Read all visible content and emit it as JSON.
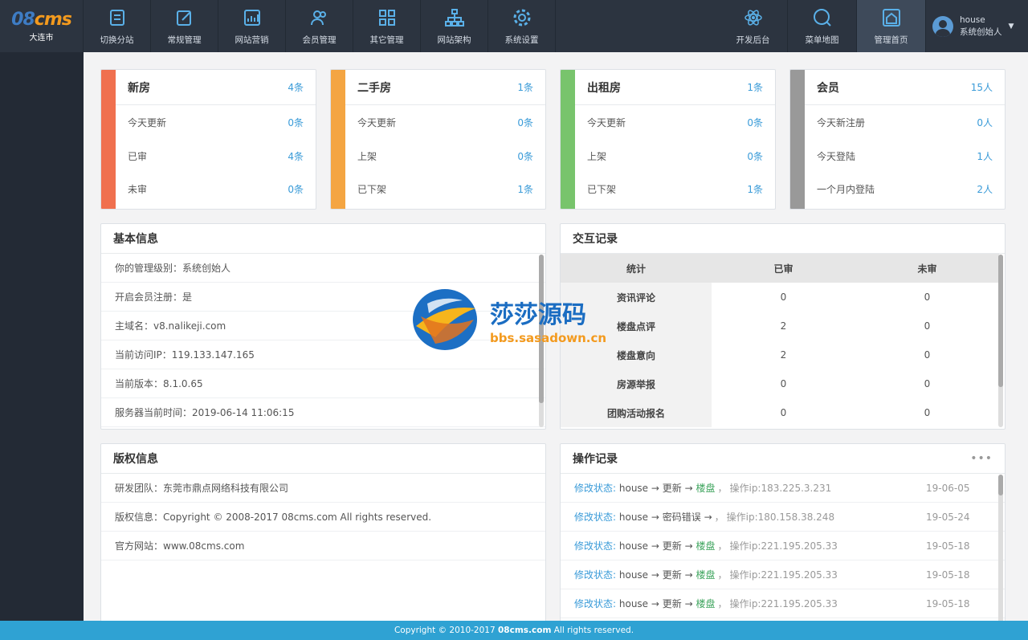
{
  "logo": {
    "prefix": "08",
    "brand": "cms",
    "city": "大连市"
  },
  "nav_left": [
    {
      "label": "切换分站",
      "icon": "switch-icon"
    },
    {
      "label": "常规管理",
      "icon": "edit-icon"
    },
    {
      "label": "网站营销",
      "icon": "chart-icon"
    },
    {
      "label": "会员管理",
      "icon": "users-icon"
    },
    {
      "label": "其它管理",
      "icon": "grid-icon"
    },
    {
      "label": "网站架构",
      "icon": "sitemap-icon"
    },
    {
      "label": "系统设置",
      "icon": "gear-icon"
    }
  ],
  "nav_right": [
    {
      "label": "开发后台",
      "icon": "atom-icon"
    },
    {
      "label": "菜单地图",
      "icon": "search-icon"
    },
    {
      "label": "管理首页",
      "icon": "home-icon",
      "active": true
    }
  ],
  "user": {
    "name": "house",
    "role": "系统创始人"
  },
  "stats": [
    {
      "title": "新房",
      "total": "4条",
      "color": "#f0704f",
      "rows": [
        {
          "label": "今天更新",
          "value": "0条"
        },
        {
          "label": "已审",
          "value": "4条"
        },
        {
          "label": "未审",
          "value": "0条"
        }
      ]
    },
    {
      "title": "二手房",
      "total": "1条",
      "color": "#f4a542",
      "rows": [
        {
          "label": "今天更新",
          "value": "0条"
        },
        {
          "label": "上架",
          "value": "0条"
        },
        {
          "label": "已下架",
          "value": "1条"
        }
      ]
    },
    {
      "title": "出租房",
      "total": "1条",
      "color": "#78c46c",
      "rows": [
        {
          "label": "今天更新",
          "value": "0条"
        },
        {
          "label": "上架",
          "value": "0条"
        },
        {
          "label": "已下架",
          "value": "1条"
        }
      ]
    },
    {
      "title": "会员",
      "total": "15人",
      "color": "#999999",
      "rows": [
        {
          "label": "今天新注册",
          "value": "0人"
        },
        {
          "label": "今天登陆",
          "value": "1人"
        },
        {
          "label": "一个月内登陆",
          "value": "2人"
        }
      ]
    }
  ],
  "basic_info": {
    "title": "基本信息",
    "rows": [
      "你的管理级别：系统创始人",
      "开启会员注册：是",
      "主域名：v8.nalikeji.com",
      "当前访问IP：119.133.147.165",
      "当前版本：8.1.0.65",
      "服务器当前时间：2019-06-14 11:06:15"
    ]
  },
  "interaction": {
    "title": "交互记录",
    "headers": [
      "统计",
      "已审",
      "未审"
    ],
    "rows": [
      [
        "资讯评论",
        "0",
        "0"
      ],
      [
        "楼盘点评",
        "2",
        "0"
      ],
      [
        "楼盘意向",
        "2",
        "0"
      ],
      [
        "房源举报",
        "0",
        "0"
      ],
      [
        "团购活动报名",
        "0",
        "0"
      ]
    ]
  },
  "copyright": {
    "title": "版权信息",
    "rows": [
      "研发团队：东莞市鼎点网络科技有限公司",
      "版权信息：Copyright © 2008-2017 08cms.com All rights reserved.",
      "官方网站：www.08cms.com"
    ]
  },
  "oplog": {
    "title": "操作记录",
    "more": "•••",
    "rows": [
      {
        "action": "修改状态:",
        "user": "house",
        "op": "更新",
        "target": "楼盘",
        "ip": "操作ip:183.225.3.231",
        "date": "19-06-05"
      },
      {
        "action": "修改状态:",
        "user": "house",
        "op": "密码错误",
        "target": "",
        "ip": "操作ip:180.158.38.248",
        "date": "19-05-24"
      },
      {
        "action": "修改状态:",
        "user": "house",
        "op": "更新",
        "target": "楼盘",
        "ip": "操作ip:221.195.205.33",
        "date": "19-05-18"
      },
      {
        "action": "修改状态:",
        "user": "house",
        "op": "更新",
        "target": "楼盘",
        "ip": "操作ip:221.195.205.33",
        "date": "19-05-18"
      },
      {
        "action": "修改状态:",
        "user": "house",
        "op": "更新",
        "target": "楼盘",
        "ip": "操作ip:221.195.205.33",
        "date": "19-05-18"
      }
    ]
  },
  "watermark": {
    "cn": "莎莎源码",
    "en": "bbs.sasadown.cn"
  },
  "footer": {
    "prefix": "Copyright © 2010-2017 ",
    "brand": "08cms.com",
    "suffix": " All rights reserved."
  }
}
